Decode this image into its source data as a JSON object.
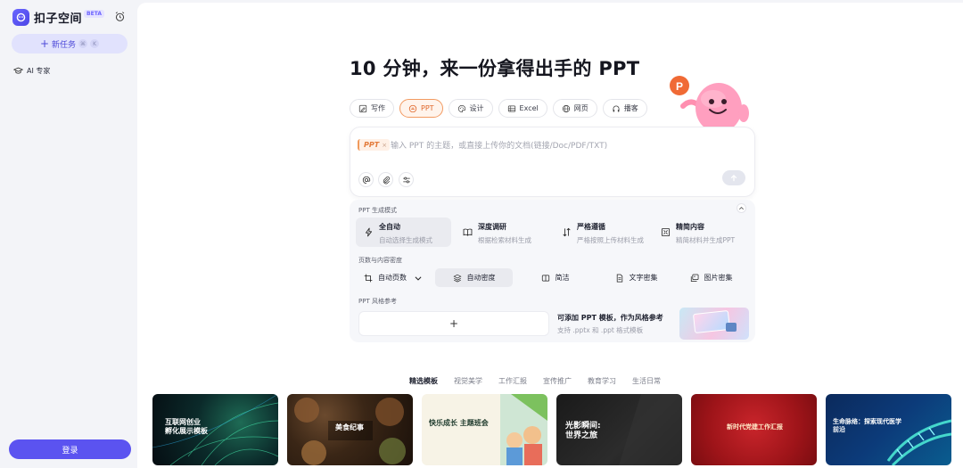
{
  "sidebar": {
    "brand": "扣子空间",
    "beta": "BETA",
    "new_task": "新任务",
    "new_task_keys": [
      "⌘",
      "K"
    ],
    "ai_expert": "AI 专家",
    "login": "登录"
  },
  "main": {
    "headline": "10 分钟，来一份拿得出手的 PPT",
    "tabs": [
      {
        "label": "写作",
        "icon": "write-icon"
      },
      {
        "label": "PPT",
        "icon": "ppt-icon"
      },
      {
        "label": "设计",
        "icon": "palette-icon"
      },
      {
        "label": "Excel",
        "icon": "table-icon"
      },
      {
        "label": "网页",
        "icon": "globe-icon"
      },
      {
        "label": "播客",
        "icon": "headphones-icon"
      }
    ],
    "active_tab": "PPT",
    "prompt": {
      "tag": "PPT",
      "tag_close": "×",
      "placeholder": "输入 PPT 的主题，或直接上传你的文档(链接/Doc/PDF/TXT)"
    },
    "gen_mode": {
      "label": "PPT 生成模式",
      "modes": [
        {
          "title": "全自动",
          "desc": "自动选择生成模式"
        },
        {
          "title": "深度调研",
          "desc": "根据检索材料生成"
        },
        {
          "title": "严格遵循",
          "desc": "严格按照上传材料生成"
        },
        {
          "title": "精简内容",
          "desc": "精简材料并生成PPT"
        }
      ]
    },
    "density": {
      "label": "页数与内容密度",
      "pages": "自动页数",
      "options": [
        "自动密度",
        "简洁",
        "文字密集",
        "图片密集"
      ]
    },
    "style_ref": {
      "label": "PPT 风格参考",
      "add": "+",
      "title": "可添加 PPT 模板，作为风格参考",
      "desc": "支持 .pptx 和 .ppt 格式模板"
    },
    "categories": [
      "精选模板",
      "视觉美学",
      "工作汇报",
      "宣传推广",
      "教育学习",
      "生活日常"
    ],
    "templates": [
      {
        "title": "互联网创业\n孵化展示模板"
      },
      {
        "title": "美食纪事"
      },
      {
        "title": "快乐成长\n主题班会"
      },
      {
        "title": "光影瞬间:\n世界之旅"
      },
      {
        "title": "新时代党建工作汇报"
      },
      {
        "title": "生命脉络：探索现代医学\n前沿"
      }
    ]
  },
  "colors": {
    "accent": "#5b53f0",
    "ppt_orange": "#e0672a"
  }
}
